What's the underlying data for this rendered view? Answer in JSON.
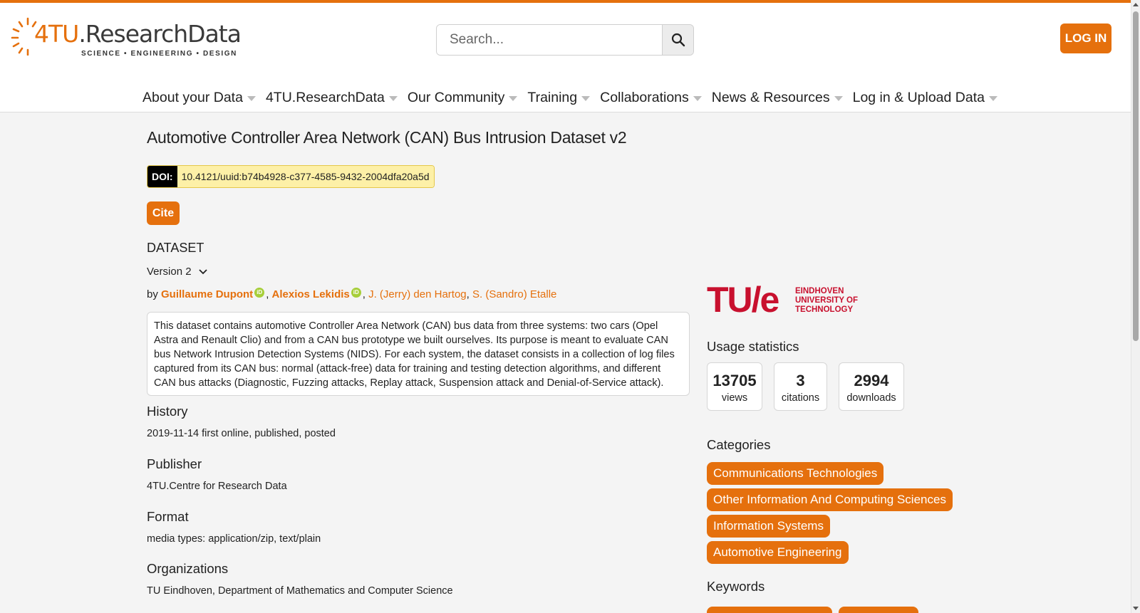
{
  "brand": {
    "name_part1": "4TU",
    "name_part2": ".ResearchData",
    "tagline": "SCIENCE • ENGINEERING • DESIGN",
    "accent_color": "#e5700d"
  },
  "search": {
    "placeholder": "Search...",
    "icon": "search-icon"
  },
  "header": {
    "login_label": "LOG IN"
  },
  "nav": {
    "items": [
      {
        "label": "About your Data"
      },
      {
        "label": "4TU.ResearchData"
      },
      {
        "label": "Our Community"
      },
      {
        "label": "Training"
      },
      {
        "label": "Collaborations"
      },
      {
        "label": "News & Resources"
      },
      {
        "label": "Log in & Upload Data"
      }
    ]
  },
  "dataset": {
    "title": "Automotive Controller Area Network (CAN) Bus Intrusion Dataset v2",
    "doi_label": "DOI:",
    "doi_value": "10.4121/uuid:b74b4928-c377-4585-9432-2004dfa20a5d",
    "cite_label": "Cite",
    "type": "DATASET",
    "version": "Version 2",
    "by": "by",
    "authors": [
      {
        "name": "Guillaume Dupont",
        "orcid": true
      },
      {
        "name": "Alexios Lekidis",
        "orcid": true
      },
      {
        "name": "J. (Jerry) den Hartog",
        "orcid": false
      },
      {
        "name": "S. (Sandro) Etalle",
        "orcid": false
      }
    ],
    "orcid_text": "iD",
    "description": "This dataset contains automotive Controller Area Network (CAN) bus data from three systems: two cars (Opel Astra and Renault Clio) and from a CAN bus prototype we built ourselves. Its purpose is meant to evaluate CAN bus Network Intrusion Detection Systems (NIDS). For each system, the dataset consists in a collection of log files captured from its CAN bus: normal (attack-free) data for training and testing detection algorithms, and different CAN bus attacks (Diagnostic, Fuzzing attacks, Replay attack, Suspension attack and Denial-of-Service attack).",
    "sections": [
      {
        "heading": "History",
        "value": "2019-11-14 first online, published, posted"
      },
      {
        "heading": "Publisher",
        "value": "4TU.Centre for Research Data"
      },
      {
        "heading": "Format",
        "value": "media types: application/zip, text/plain"
      },
      {
        "heading": "Organizations",
        "value": "TU Eindhoven, Department of Mathematics and Computer Science"
      }
    ]
  },
  "sidebar": {
    "institution": {
      "logo_text": "TU/e",
      "line1": "EINDHOVEN",
      "line2": "UNIVERSITY OF",
      "line3": "TECHNOLOGY",
      "color": "#c8102e"
    },
    "usage_heading": "Usage statistics",
    "stats": [
      {
        "value": "13705",
        "label": "views"
      },
      {
        "value": "3",
        "label": "citations"
      },
      {
        "value": "2994",
        "label": "downloads"
      }
    ],
    "categories_heading": "Categories",
    "categories": [
      "Communications Technologies",
      "Other Information And Computing Sciences",
      "Information Systems",
      "Automotive Engineering"
    ],
    "keywords_heading": "Keywords"
  }
}
